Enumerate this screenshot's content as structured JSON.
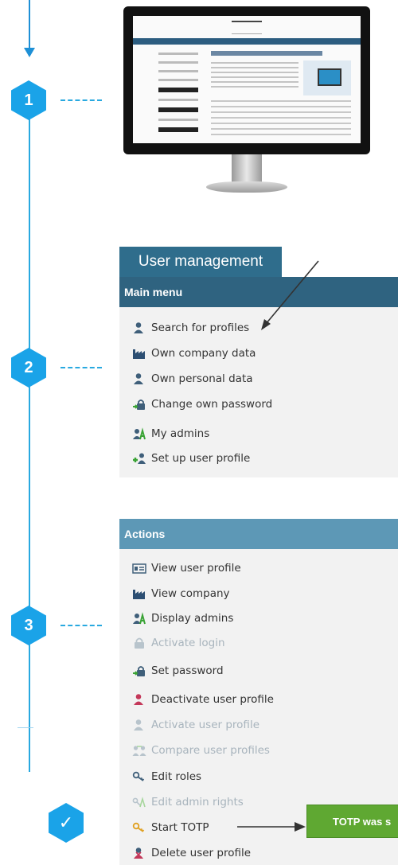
{
  "steps": [
    {
      "number": "1"
    },
    {
      "number": "2"
    },
    {
      "number": "3"
    }
  ],
  "check_symbol": "✓",
  "user_management": {
    "tab_label": "User management",
    "main_menu_header": "Main menu",
    "main_menu_items": [
      {
        "label": "Search for profiles",
        "icon": "person-icon"
      },
      {
        "label": "Own company data",
        "icon": "factory-icon"
      },
      {
        "label": "Own personal data",
        "icon": "person-icon"
      },
      {
        "label": "Change own password",
        "icon": "lock-arrow-icon"
      },
      {
        "label": "My admins",
        "icon": "admin-icon"
      },
      {
        "label": "Set up user profile",
        "icon": "add-person-icon"
      }
    ],
    "actions_header": "Actions",
    "action_items": [
      {
        "label": "View user profile",
        "icon": "id-card-icon",
        "enabled": true
      },
      {
        "label": "View company",
        "icon": "factory-icon",
        "enabled": true
      },
      {
        "label": "Display admins",
        "icon": "admin-icon",
        "enabled": true
      },
      {
        "label": "Activate login",
        "icon": "lock-icon",
        "enabled": false
      },
      {
        "label": "Set password",
        "icon": "lock-arrow-icon",
        "enabled": true
      },
      {
        "label": "Deactivate user profile",
        "icon": "person-red-icon",
        "enabled": true
      },
      {
        "label": "Activate user profile",
        "icon": "person-icon",
        "enabled": false
      },
      {
        "label": "Compare user profiles",
        "icon": "compare-icon",
        "enabled": false
      },
      {
        "label": "Edit roles",
        "icon": "key-icon",
        "enabled": true
      },
      {
        "label": "Edit admin rights",
        "icon": "keys-icon",
        "enabled": false
      },
      {
        "label": "Start TOTP",
        "icon": "key-yellow-icon",
        "enabled": true
      },
      {
        "label": "Delete user profile",
        "icon": "person-delete-icon",
        "enabled": true
      }
    ]
  },
  "toast": {
    "text": "TOTP was s"
  },
  "colors": {
    "timeline_blue": "#29a9e0",
    "hex_blue": "#1aa3e8",
    "tab_blue": "#2f6d8c",
    "main_menu_header": "#2f6380",
    "actions_header": "#5d98b6",
    "panel_bg": "#f2f2f2",
    "toast_green": "#5fa832"
  }
}
